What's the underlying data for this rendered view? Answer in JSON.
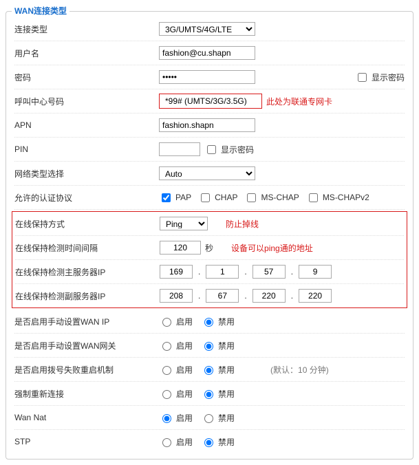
{
  "legend": "WAN连接类型",
  "labels": {
    "connType": "连接类型",
    "username": "用户名",
    "password": "密码",
    "showPassword": "显示密码",
    "dialNumber": "呼叫中心号码",
    "apn": "APN",
    "pin": "PIN",
    "showPin": "显示密码",
    "netType": "网络类型选择",
    "authProto": "允许的认证协议",
    "keepMethod": "在线保持方式",
    "keepInterval": "在线保持检测时间间隔",
    "intervalUnit": "秒",
    "primaryIp": "在线保持检测主服务器IP",
    "secondaryIp": "在线保持检测副服务器IP",
    "manualWanIp": "是否启用手动设置WAN IP",
    "manualWanGw": "是否启用手动设置WAN网关",
    "dialFailRestart": "是否启用拨号失败重启机制",
    "dialFailDefault": "(默认：10 分钟)",
    "forceReconnect": "强制重新连接",
    "wanNat": "Wan Nat",
    "stp": "STP"
  },
  "values": {
    "connType": "3G/UMTS/4G/LTE",
    "username": "fashion@cu.shapn",
    "password": "•••••",
    "dialNumber": "*99# (UMTS/3G/3.5G)",
    "apn": "fashion.shapn",
    "pin": "",
    "netType": "Auto",
    "keepMethod": "Ping",
    "keepInterval": "120",
    "ip1": {
      "a": "169",
      "b": "1",
      "c": "57",
      "d": "9"
    },
    "ip2": {
      "a": "208",
      "b": "67",
      "c": "220",
      "d": "220"
    }
  },
  "auth": {
    "pap": "PAP",
    "chap": "CHAP",
    "mschap": "MS-CHAP",
    "mschapv2": "MS-CHAPv2"
  },
  "radio": {
    "enable": "启用",
    "disable": "禁用"
  },
  "annotations": {
    "dialNote": "此处为联通专网卡",
    "keepNote": "防止掉线",
    "ipNote": "设备可以ping通的地址"
  }
}
